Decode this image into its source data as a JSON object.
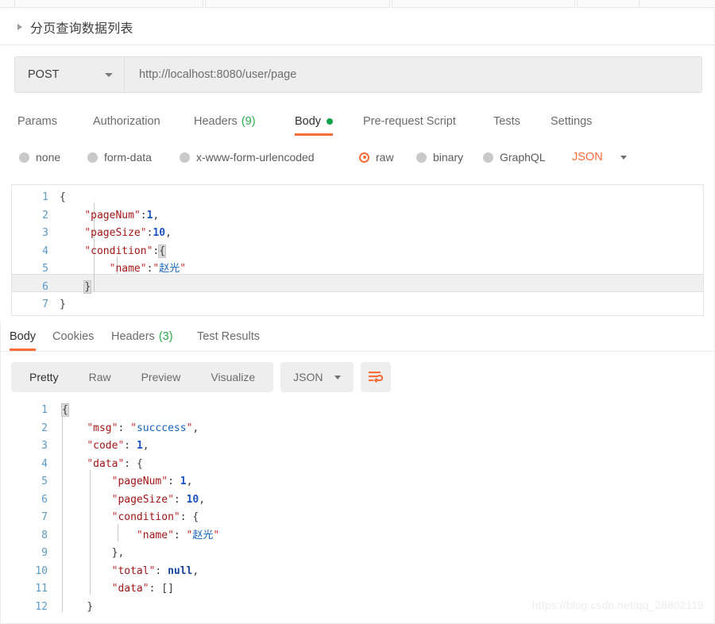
{
  "request_title": {
    "label": "分页查询数据列表",
    "collapse_icon": "triangle-right-icon"
  },
  "url_bar": {
    "method": "POST",
    "method_caret": "chevron-down-icon",
    "url": "http://localhost:8080/user/page"
  },
  "request_tabs": [
    {
      "label": "Params",
      "active": false,
      "count": ""
    },
    {
      "label": "Authorization",
      "active": false,
      "count": ""
    },
    {
      "label": "Headers",
      "active": false,
      "count": "(9)"
    },
    {
      "label": "Body",
      "active": true,
      "count": ""
    },
    {
      "label": "Pre-request Script",
      "active": false,
      "count": ""
    },
    {
      "label": "Tests",
      "active": false,
      "count": ""
    },
    {
      "label": "Settings",
      "active": false,
      "count": ""
    }
  ],
  "body_types": [
    {
      "label": "none",
      "selected": false
    },
    {
      "label": "form-data",
      "selected": false
    },
    {
      "label": "x-www-form-urlencoded",
      "selected": false
    },
    {
      "label": "raw",
      "selected": true
    },
    {
      "label": "binary",
      "selected": false
    },
    {
      "label": "GraphQL",
      "selected": false
    }
  ],
  "body_format": {
    "label": "JSON",
    "caret": "chevron-down-icon"
  },
  "request_body": {
    "line_numbers": [
      "1",
      "2",
      "3",
      "4",
      "5",
      "6",
      "7"
    ],
    "lines": [
      "{",
      "    \"pageNum\":1,",
      "    \"pageSize\":10,",
      "    \"condition\":{",
      "        \"name\":\"赵光\"",
      "    }",
      "}"
    ],
    "active_line": 6
  },
  "response_tabs": [
    {
      "label": "Body",
      "active": true,
      "count": ""
    },
    {
      "label": "Cookies",
      "active": false,
      "count": ""
    },
    {
      "label": "Headers",
      "active": false,
      "count": "(3)"
    },
    {
      "label": "Test Results",
      "active": false,
      "count": ""
    }
  ],
  "response_toolbar": {
    "views": [
      {
        "label": "Pretty",
        "active": true
      },
      {
        "label": "Raw",
        "active": false
      },
      {
        "label": "Preview",
        "active": false
      },
      {
        "label": "Visualize",
        "active": false
      }
    ],
    "format": "JSON",
    "format_caret": "chevron-down-icon",
    "wrap_button_icon": "word-wrap-icon"
  },
  "response_body": {
    "line_numbers": [
      "1",
      "2",
      "3",
      "4",
      "5",
      "6",
      "7",
      "8",
      "9",
      "10",
      "11",
      "12"
    ],
    "lines": [
      "{",
      "    \"msg\": \"succcess\",",
      "    \"code\": 1,",
      "    \"data\": {",
      "        \"pageNum\": 1,",
      "        \"pageSize\": 10,",
      "        \"condition\": {",
      "            \"name\": \"赵光\"",
      "        },",
      "        \"total\": null,",
      "        \"data\": []",
      "    }"
    ]
  },
  "watermark": "https://blog.csdn.net/qq_28802119",
  "colors": {
    "accent": "#ff6c37",
    "count_green": "#2aab4a",
    "dot_green": "#0fa14c",
    "json_key": "#a31515",
    "json_string": "#1565c0",
    "json_number": "#1a52c4"
  }
}
